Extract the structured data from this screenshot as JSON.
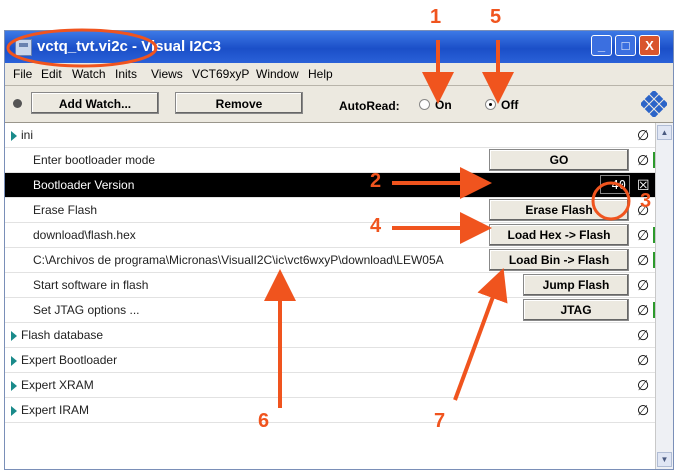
{
  "window": {
    "title": "vctq_tvt.vi2c - Visual I2C3",
    "min_label": "_",
    "max_label": "□",
    "close_label": "X"
  },
  "menu": [
    "File",
    "Edit",
    "Watch",
    "Inits",
    "Views",
    "VCT69xyP",
    "Window",
    "Help"
  ],
  "toolbar": {
    "add_watch_label": "Add Watch...",
    "remove_label": "Remove",
    "autoread_label": "AutoRead:",
    "on_label": "On",
    "off_label": "Off",
    "autoread_selected": "Off"
  },
  "rows": [
    {
      "text": "ini",
      "type": "group"
    },
    {
      "text": "Enter bootloader mode",
      "button": "GO"
    },
    {
      "text": "Bootloader Version",
      "value": "40",
      "selected": true
    },
    {
      "text": "Erase Flash",
      "button": "Erase Flash"
    },
    {
      "text": "download\\flash.hex",
      "button": "Load Hex -> Flash"
    },
    {
      "text": "C:\\Archivos de programa\\Micronas\\VisualI2C\\ic\\vct6wxyP\\download\\LEW05A",
      "button": "Load Bin -> Flash"
    },
    {
      "text": "Start software in flash",
      "button": "Jump Flash"
    },
    {
      "text": "Set JTAG options ...",
      "button": "JTAG"
    },
    {
      "text": "Flash database",
      "type": "group"
    },
    {
      "text": "Expert Bootloader",
      "type": "group"
    },
    {
      "text": "Expert XRAM",
      "type": "group"
    },
    {
      "text": "Expert IRAM",
      "type": "group"
    }
  ],
  "state_symbols": {
    "normal": "∅",
    "checked": "☒"
  },
  "scroll": {
    "up": "▲",
    "down": "▼"
  },
  "annotations": [
    "1",
    "2",
    "3",
    "4",
    "5",
    "6",
    "7"
  ],
  "colors": {
    "annotation": "#f0541e",
    "titlebar": "#1b4fc8",
    "close": "#d9552d",
    "selected_row": "#000000",
    "status_green": "#2c9a2c"
  }
}
